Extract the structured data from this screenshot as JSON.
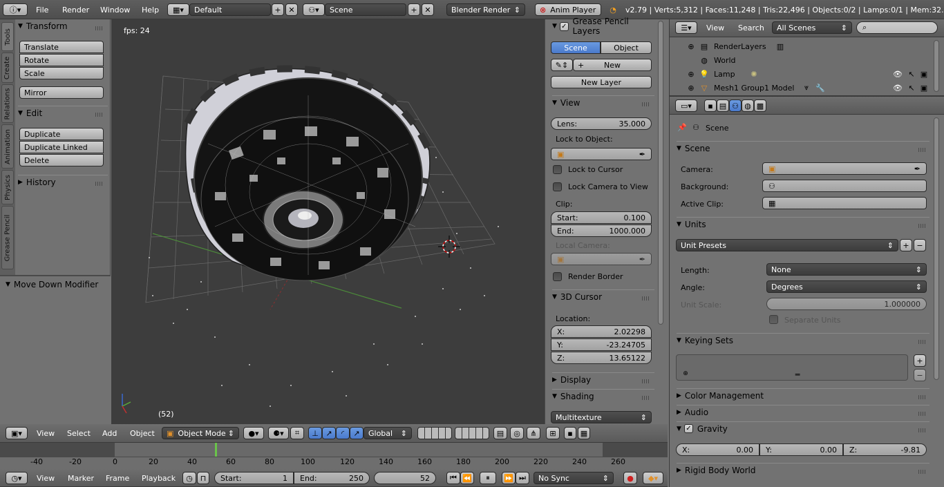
{
  "topbar": {
    "menus": [
      "File",
      "Render",
      "Window",
      "Help"
    ],
    "layout": "Default",
    "scene": "Scene",
    "engine": "Blender Render",
    "anim_player": "Anim Player",
    "stats": "v2.79 | Verts:5,312 | Faces:11,248 | Tris:22,496 | Objects:0/2 | Lamps:0/1 | Mem:32.30M"
  },
  "toolshelf": {
    "tabs": [
      "Tools",
      "Create",
      "Relations",
      "Animation",
      "Physics",
      "Grease Pencil"
    ],
    "transform_header": "Transform",
    "transform_buttons": [
      "Translate",
      "Rotate",
      "Scale"
    ],
    "mirror": "Mirror",
    "edit_header": "Edit",
    "edit_buttons": [
      "Duplicate",
      "Duplicate Linked",
      "Delete"
    ],
    "history": "History",
    "operator": "Move Down Modifier"
  },
  "viewport": {
    "fps": "fps: 24",
    "frame": "(52)"
  },
  "npanel": {
    "grease_header": "Grease Pencil Layers",
    "scene_tab": "Scene",
    "object_tab": "Object",
    "new": "New",
    "new_layer": "New Layer",
    "view_header": "View",
    "lens_label": "Lens:",
    "lens_value": "35.000",
    "lock_to_object": "Lock to Object:",
    "lock_to_cursor": "Lock to Cursor",
    "lock_camera": "Lock Camera to View",
    "clip": "Clip:",
    "start_label": "Start:",
    "start_value": "0.100",
    "end_label": "End:",
    "end_value": "1000.000",
    "local_camera": "Local Camera:",
    "render_border": "Render Border",
    "cursor_header": "3D Cursor",
    "location": "Location:",
    "x_label": "X:",
    "x_value": "2.02298",
    "y_label": "Y:",
    "y_value": "-23.24705",
    "z_label": "Z:",
    "z_value": "13.65122",
    "display": "Display",
    "shading": "Shading",
    "shading_mode": "Multitexture"
  },
  "viewheader": {
    "view": "View",
    "select": "Select",
    "add": "Add",
    "object": "Object",
    "mode": "Object Mode",
    "orientation": "Global"
  },
  "timeline": {
    "ticks": [
      "-40",
      "-20",
      "0",
      "20",
      "40",
      "60",
      "80",
      "100",
      "120",
      "140",
      "160",
      "180",
      "200",
      "220",
      "240",
      "260"
    ],
    "view": "View",
    "marker": "Marker",
    "frame": "Frame",
    "playback": "Playback",
    "start_label": "Start:",
    "start_value": "1",
    "end_label": "End:",
    "end_value": "250",
    "current": "52",
    "sync": "No Sync"
  },
  "outliner": {
    "view": "View",
    "search": "Search",
    "filter": "All Scenes",
    "items": [
      "RenderLayers",
      "World",
      "Lamp",
      "Mesh1 Group1 Model"
    ]
  },
  "properties": {
    "context": "Scene",
    "scene_header": "Scene",
    "camera": "Camera:",
    "background": "Background:",
    "active_clip": "Active Clip:",
    "units_header": "Units",
    "unit_presets": "Unit Presets",
    "length_label": "Length:",
    "length_value": "None",
    "angle_label": "Angle:",
    "angle_value": "Degrees",
    "unit_scale_label": "Unit Scale:",
    "unit_scale_value": "1.000000",
    "separate_units": "Separate Units",
    "keying_header": "Keying Sets",
    "color_mgmt": "Color Management",
    "audio": "Audio",
    "gravity": "Gravity",
    "gx_label": "X:",
    "gx": "0.00",
    "gy_label": "Y:",
    "gy": "0.00",
    "gz_label": "Z:",
    "gz": "-9.81",
    "rigid_body": "Rigid Body World"
  }
}
